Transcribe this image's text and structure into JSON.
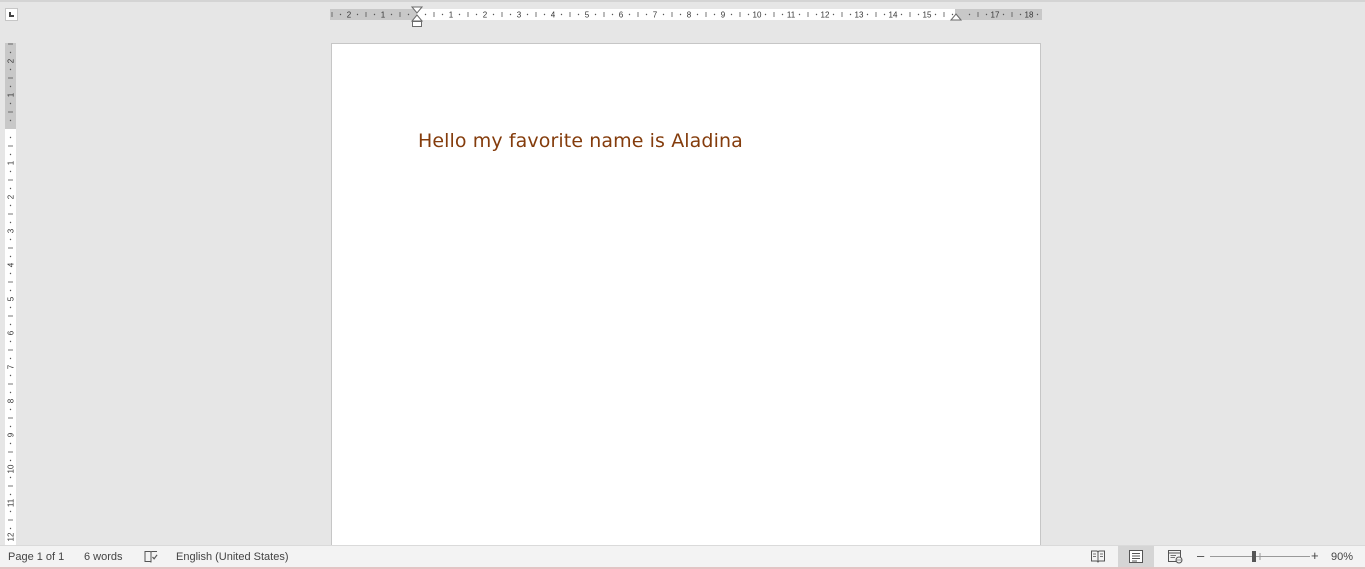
{
  "ruler": {
    "horizontal_labels": [
      "2",
      "1",
      "1",
      "2",
      "3",
      "4",
      "5",
      "6",
      "7",
      "8",
      "9",
      "10",
      "11",
      "12",
      "13",
      "14",
      "15",
      "17",
      "18"
    ],
    "vertical_labels": [
      "2",
      "1",
      "1",
      "2",
      "3",
      "4",
      "5",
      "6",
      "7",
      "8",
      "9",
      "10",
      "11",
      "12"
    ]
  },
  "document": {
    "text": "Hello my favorite name is Aladina",
    "text_color": "#843c0c"
  },
  "statusbar": {
    "page_info": "Page 1 of 1",
    "word_count": "6 words",
    "language": "English (United States)",
    "zoom_level": "90%",
    "zoom_out_label": "–",
    "zoom_in_label": "+"
  },
  "icons": {
    "proofing": "proofing-icon",
    "read_mode": "read-mode-icon",
    "print_layout": "print-layout-icon",
    "web_layout": "web-layout-icon"
  }
}
